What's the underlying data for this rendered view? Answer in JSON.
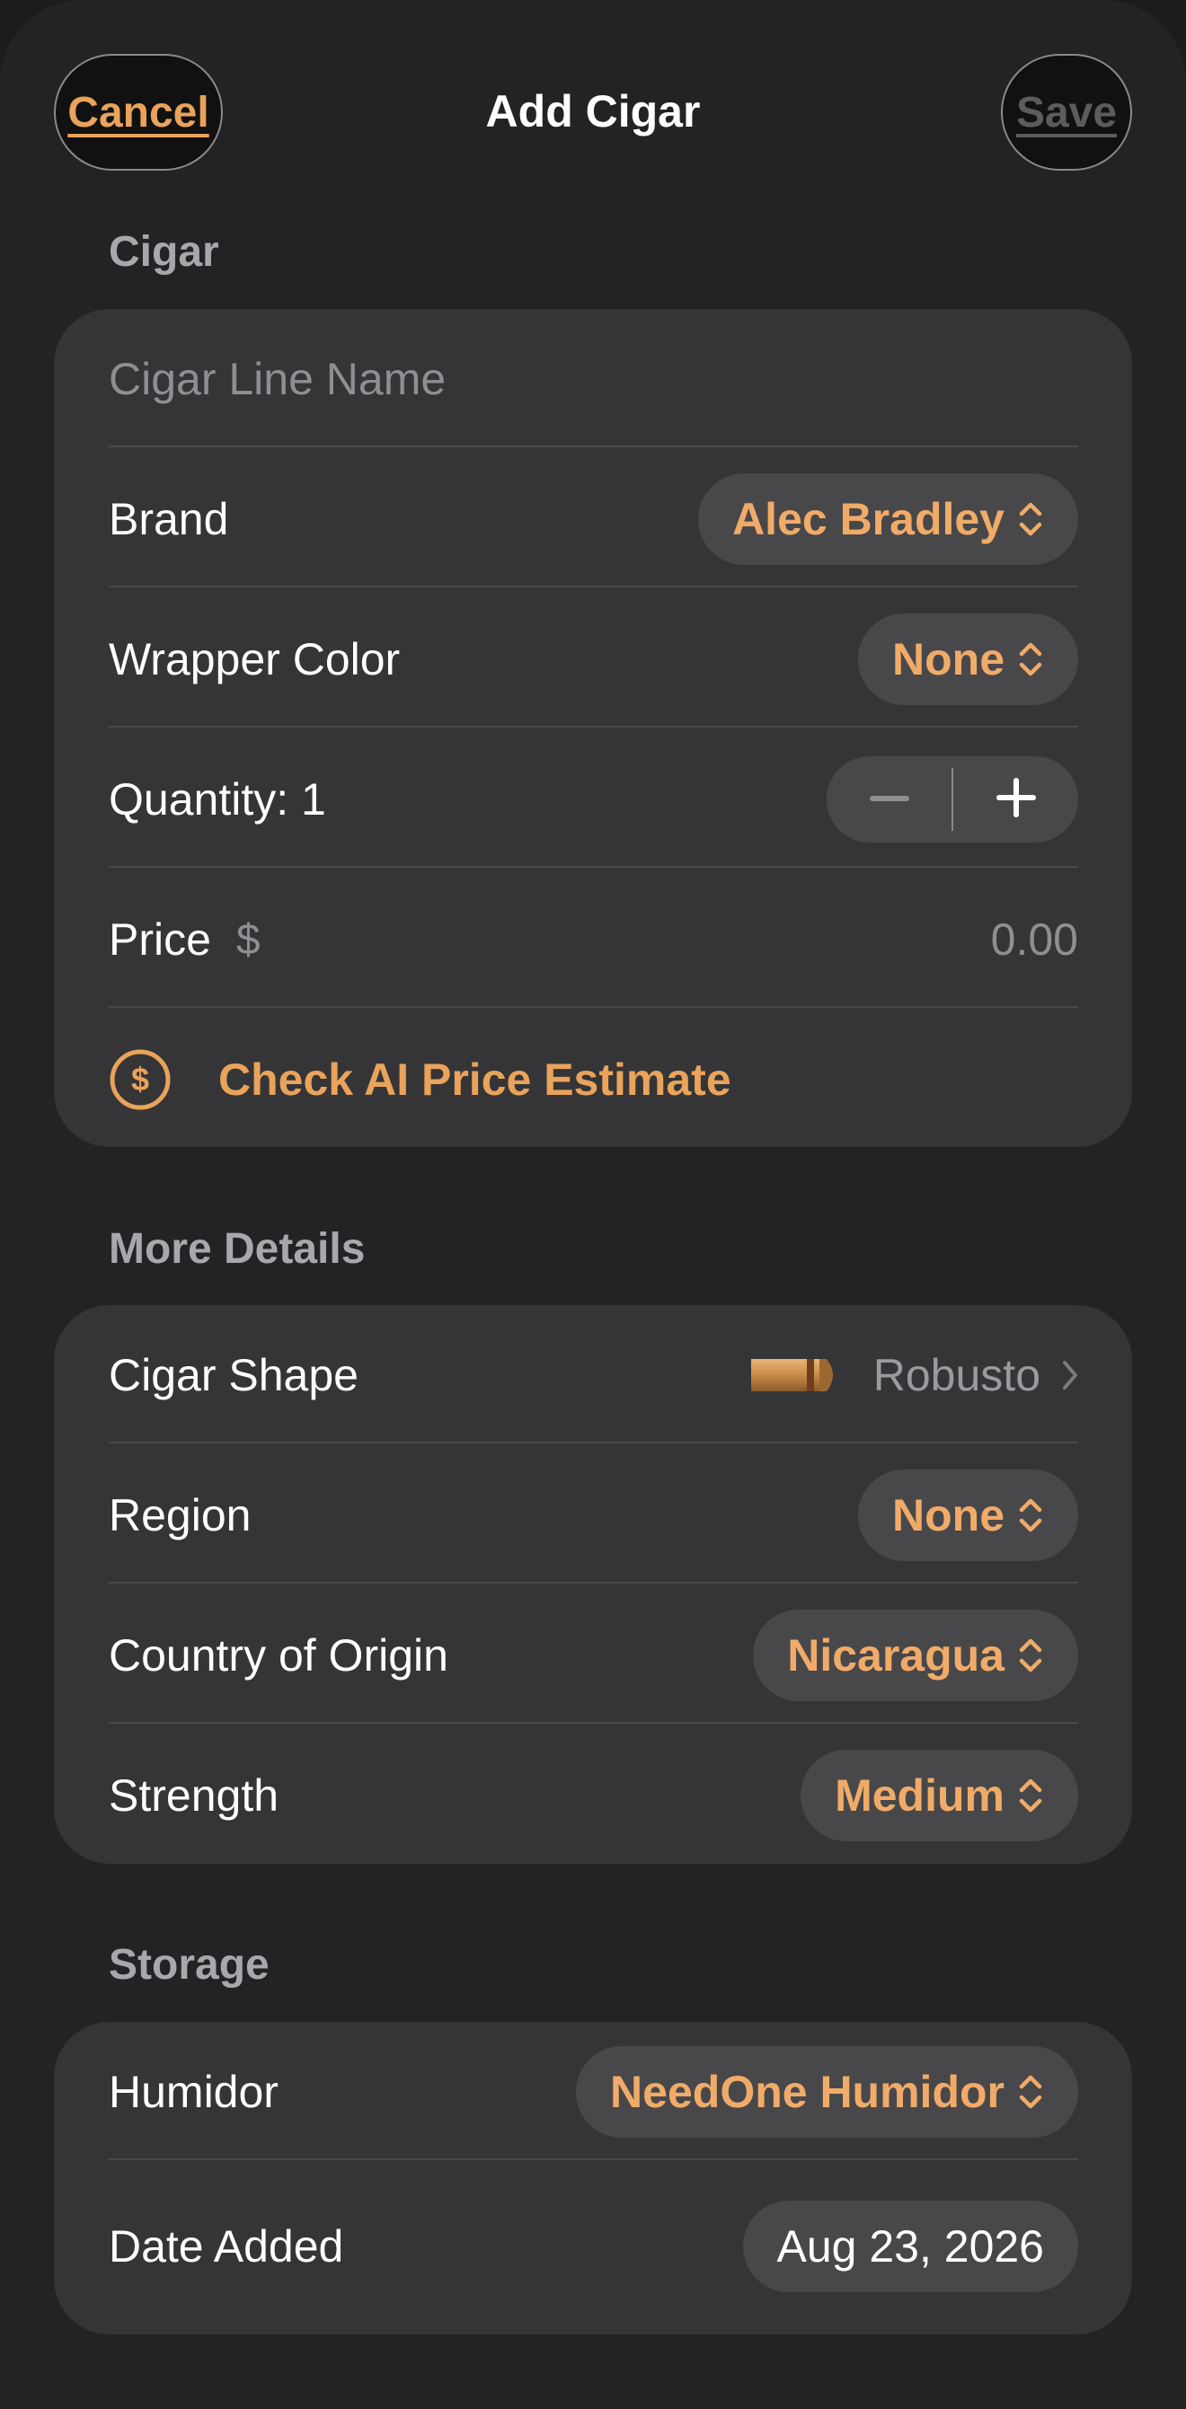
{
  "nav": {
    "cancel_label": "Cancel",
    "title": "Add Cigar",
    "save_label": "Save"
  },
  "sections": {
    "cigar": {
      "header": "Cigar",
      "name_placeholder": "Cigar Line Name",
      "brand_label": "Brand",
      "brand_value": "Alec Bradley",
      "wrapper_label": "Wrapper Color",
      "wrapper_value": "None",
      "quantity_label": "Quantity: 1",
      "price_label": "Price",
      "price_currency": "$",
      "price_placeholder": "0.00",
      "ai_estimate_label": "Check AI Price Estimate"
    },
    "details": {
      "header": "More Details",
      "shape_label": "Cigar Shape",
      "shape_value": "Robusto",
      "region_label": "Region",
      "region_value": "None",
      "country_label": "Country of Origin",
      "country_value": "Nicaragua",
      "strength_label": "Strength",
      "strength_value": "Medium"
    },
    "storage": {
      "header": "Storage",
      "humidor_label": "Humidor",
      "humidor_value": "NeedOne Humidor",
      "date_label": "Date Added",
      "date_value": "Aug 23, 2026"
    }
  },
  "icons": {
    "select_chevron": "chevron-up-down-icon",
    "stepper_minus": "minus-icon",
    "stepper_plus": "plus-icon",
    "price_estimate": "dollar-circle-icon",
    "cigar_shape": "cigar-icon",
    "disclosure": "chevron-right-icon"
  },
  "colors": {
    "background": "#232325",
    "card": "#353537",
    "accent": "#f1ab68",
    "secondary_text": "#8e8e93"
  }
}
